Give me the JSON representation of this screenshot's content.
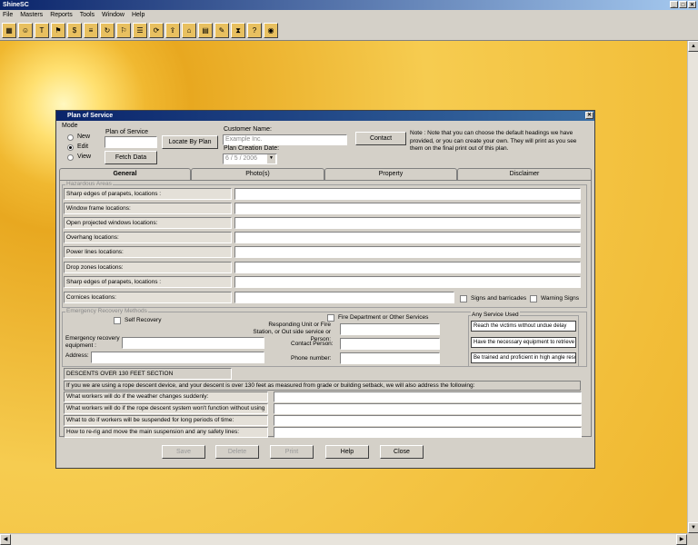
{
  "app": {
    "title": "ShineSC"
  },
  "menu": [
    "File",
    "Masters",
    "Reports",
    "Tools",
    "Window",
    "Help"
  ],
  "toolbar_icons": [
    "grid-icon",
    "person-icon",
    "tool-icon",
    "tag-icon",
    "money-icon",
    "document-icon",
    "refresh-icon",
    "flag-icon",
    "list-icon",
    "cycle-icon",
    "upload-icon",
    "lock-icon",
    "book-icon",
    "edit-icon",
    "hourglass-icon",
    "question-icon",
    "globe-icon"
  ],
  "dialog": {
    "title": "Plan of Service",
    "mode": {
      "label": "Mode",
      "options": [
        "New",
        "Edit",
        "View"
      ],
      "selected": "Edit"
    },
    "plan_of_service_label": "Plan of Service",
    "locate_by_plan": "Locate By Plan",
    "fetch_data": "Fetch Data",
    "customer_name_label": "Customer Name:",
    "customer_name_placeholder": "Example Inc.",
    "contact": "Contact",
    "plan_creation_date_label": "Plan Creation Date:",
    "plan_creation_date": "6 / 5 / 2006",
    "note": "Note : Note that you can choose the default headings we have provided, or you can create your own. They will print as you see them on the final print out of this plan.",
    "tabs": [
      "General",
      "Photo(s)",
      "Property",
      "Disclaimer"
    ],
    "hazardous_areas": {
      "title": "Hazardous Areas",
      "fields": [
        "Sharp edges of parapets, locations :",
        "Window frame locations:",
        "Open projected windows locations:",
        "Overhang locations:",
        "Power lines locations:",
        "Drop zones locations:",
        "Sharp edges of parapets, locations :",
        "Cornices locations:"
      ],
      "signs_and_barricades": "Signs and barricades",
      "warning_signs": "Warning Signs"
    },
    "emergency": {
      "title": "Emergency Recovery Methods",
      "self_recovery": "Self Recovery",
      "fire_department": "Fire Department or Other Services",
      "responding_unit": "Responding Unit or Fire Station, or Out side service or Person:",
      "equipment_label": "Emergency recovery equipment :",
      "address_label": "Address:",
      "contact_person_label": "Contact Person:",
      "phone_label": "Phone number:",
      "any_service_title": "Any Service Used",
      "any_service_items": [
        "Reach the victims without undue delay",
        "Have the necessary equipment to retrieve",
        "Be trained and proficient in high angle rescue"
      ]
    },
    "descents": {
      "title": "DESCENTS OVER 130 FEET SECTION",
      "intro": "If you we are using a rope descent device, and your descent is over 130 feet as measured from grade or building setback, we will also address the following:",
      "fields": [
        "What workers will do if the weather changes suddenly:",
        "What workers will do if the rope descent system won't function without using",
        "What to do if workers will be suspended for long periods of time:",
        "How to re-rig and move the main suspension and any safety lines:"
      ]
    },
    "buttons": {
      "save": "Save",
      "delete": "Delete",
      "print": "Print",
      "help": "Help",
      "close": "Close"
    }
  }
}
